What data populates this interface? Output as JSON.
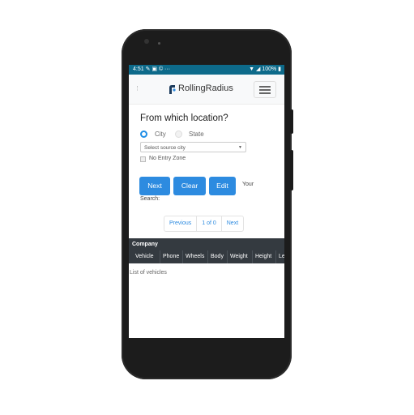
{
  "status_bar": {
    "time": "4:51",
    "left_icons": "✎ ▣ © ···",
    "right": "▼ ◢ 100% ▮"
  },
  "navbar": {
    "menu_dots": "⋮",
    "brand": "RollingRadius"
  },
  "form": {
    "question": "From which location?",
    "radio_city": "City",
    "radio_state": "State",
    "select_value": "Select source city",
    "checkbox_label": "No Entry Zone"
  },
  "buttons": {
    "next": "Next",
    "clear": "Clear",
    "edit": "Edit"
  },
  "search": {
    "your": "Your",
    "search_label": "Search:"
  },
  "pagination": {
    "previous": "Previous",
    "page_info": "1 of 0",
    "next": "Next"
  },
  "table": {
    "group_header": "Company",
    "columns": [
      "Vehicle",
      "Phone",
      "Wheels",
      "Body",
      "Weight",
      "Height",
      "Le"
    ]
  },
  "list_label": "List of vehicles",
  "colors": {
    "accent": "#2d8be0",
    "status_bar": "#0d6a8a",
    "table_header": "#343a40"
  }
}
